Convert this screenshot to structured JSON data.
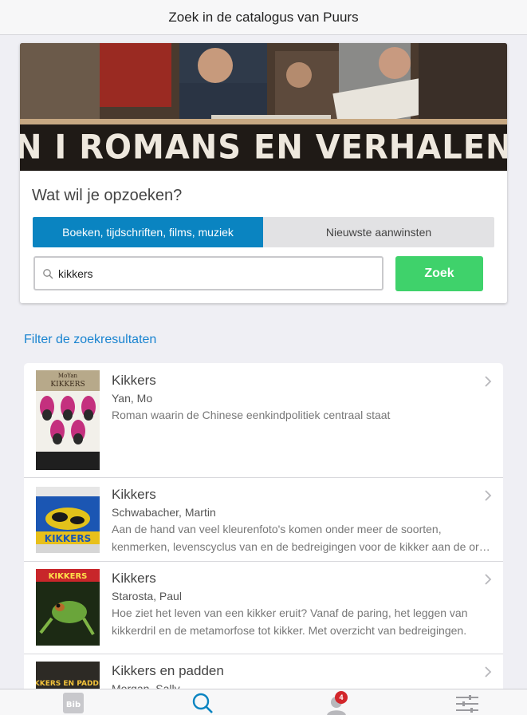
{
  "header": {
    "title": "Zoek in de catalogus van Puurs"
  },
  "banner": {
    "text": "N  I  ROMANS EN VERHALEN  I  BEEL"
  },
  "search": {
    "question": "Wat wil je opzoeken?",
    "tabs": [
      {
        "label": "Boeken, tijdschriften, films, muziek",
        "active": true
      },
      {
        "label": "Nieuwste aanwinsten",
        "active": false
      }
    ],
    "value": "kikkers",
    "button_label": "Zoek"
  },
  "filter": {
    "label": "Filter de zoekresultaten"
  },
  "results": [
    {
      "title": "Kikkers",
      "author": "Yan, Mo",
      "desc1": "Roman waarin de Chinese eenkindpolitiek centraal staat",
      "desc2": ""
    },
    {
      "title": "Kikkers",
      "author": "Schwabacher, Martin",
      "desc1": "Aan de hand van veel kleurenfoto's komen onder meer de soorten,",
      "desc2": "kenmerken, levenscyclus van en de bedreigingen voor de kikker aan de orde."
    },
    {
      "title": "Kikkers",
      "author": "Starosta, Paul",
      "desc1": "Hoe ziet het leven van een kikker eruit? Vanaf de paring, het leggen van",
      "desc2": "kikkerdril en de metamorfose tot kikker. Met overzicht van bedreigingen."
    },
    {
      "title": "Kikkers en padden",
      "author": "Morgan, Sally",
      "desc1": "",
      "desc2": ""
    }
  ],
  "covers": [
    {
      "top_text": "MoYan",
      "title_text": "KIKKERS"
    },
    {
      "title_text": "KIKKERS"
    },
    {
      "title_text": "KIKKERS"
    },
    {
      "title_text": "KIKKERS EN PADDEN"
    }
  ],
  "bottom_nav": {
    "logo_text": "Bib",
    "badge_count": "4",
    "items": [
      "home-logo",
      "search-icon",
      "account-icon",
      "settings-sliders-icon"
    ]
  },
  "colors": {
    "accent": "#0a84c1",
    "button": "#3fd26b",
    "link": "#1a84d0",
    "badge": "#d2262b"
  }
}
